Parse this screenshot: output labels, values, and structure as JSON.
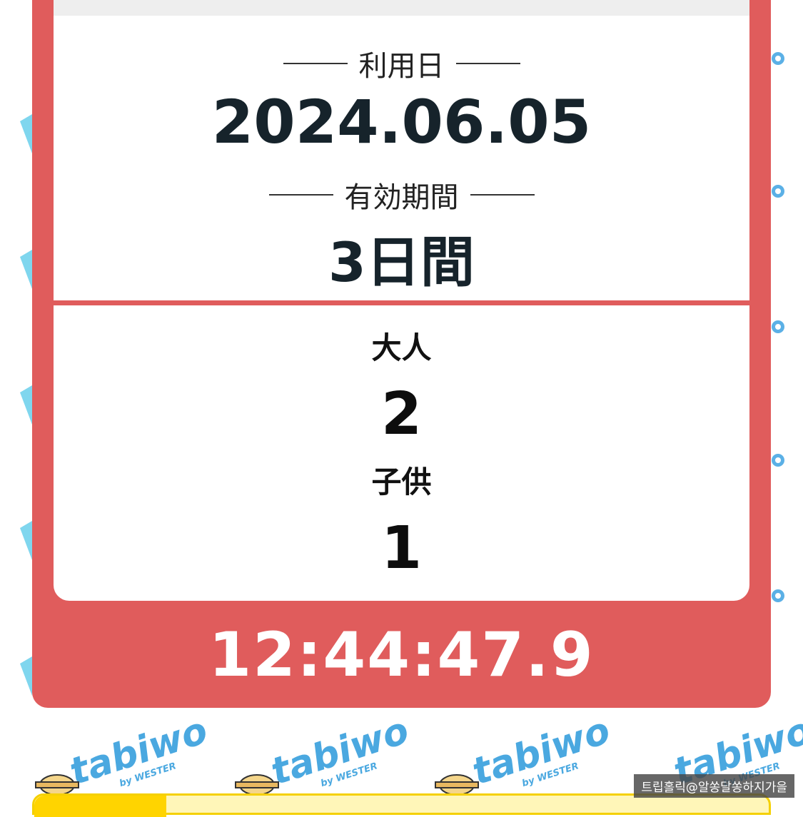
{
  "usage_date": {
    "label": "利用日",
    "value": "2024.06.05"
  },
  "validity": {
    "label": "有効期間",
    "value": "3日間"
  },
  "adults": {
    "label": "大人",
    "count": "2"
  },
  "children": {
    "label": "子供",
    "count": "1"
  },
  "timer": "12:44:47.9",
  "background": {
    "brand": "tabiwo",
    "brand_sub": "by WESTER",
    "icon": "bear-mascot-icon"
  },
  "watermark": "트립홀릭@알쏭달쏭하지가을",
  "colors": {
    "ticket": "#e05c5c",
    "text_dark": "#16232b",
    "brand_blue": "#4aa8e0",
    "brand_yellow": "#ffd400"
  }
}
